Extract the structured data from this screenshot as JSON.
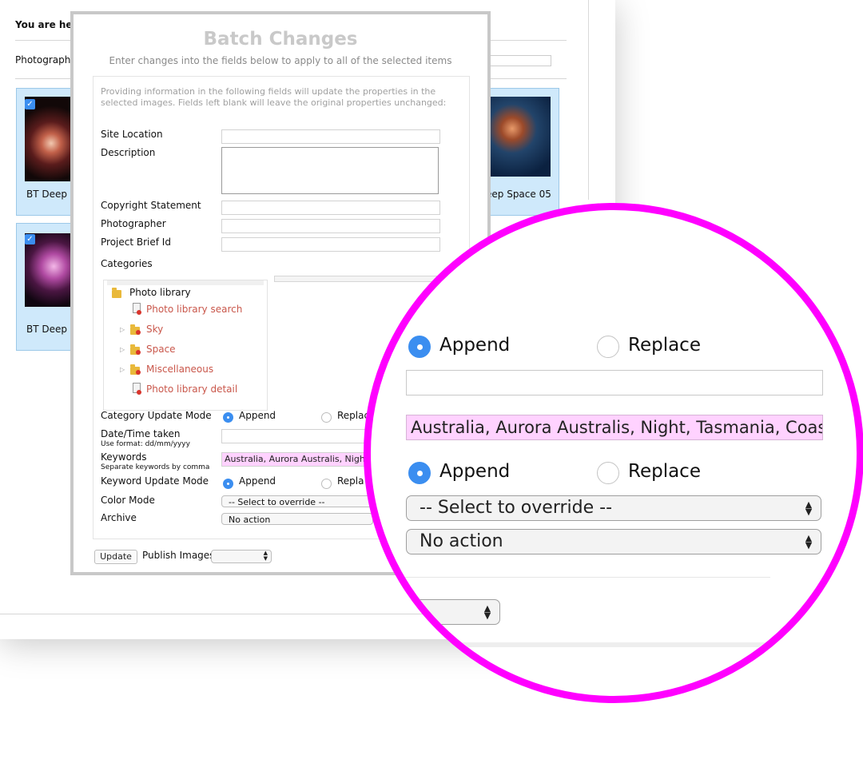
{
  "background": {
    "breadcrumb_label": "You are her",
    "photographer_label": "Photographe",
    "tiles": [
      {
        "label": "BT Deep S"
      },
      {
        "label": "BT Deep S"
      },
      {
        "label": "eep Space 05"
      }
    ]
  },
  "dialog": {
    "title": "Batch Changes",
    "subtitle": "Enter changes into the fields below to apply to all of the selected items",
    "info": "Providing information in the following fields will update the properties in the selected images. Fields left blank will leave the original properties unchanged:",
    "fields": {
      "site_location": "Site Location",
      "description": "Description",
      "copyright": "Copyright Statement",
      "photographer": "Photographer",
      "project_brief": "Project Brief Id",
      "categories": "Categories",
      "category_update_mode": "Category Update Mode",
      "date_taken": "Date/Time taken",
      "date_hint": "Use format: dd/mm/yyyy",
      "keywords": "Keywords",
      "keywords_hint": "Separate keywords by comma",
      "keyword_update_mode": "Keyword Update Mode",
      "color_mode": "Color Mode",
      "archive": "Archive"
    },
    "tree": {
      "root": "Photo library",
      "items": [
        "Photo library search",
        "Sky",
        "Space",
        "Miscellaneous",
        "Photo library detail"
      ]
    },
    "append_label": "Append",
    "replace_label_cut": "Replac",
    "replace_label_cut2": "Repla",
    "keywords_value": "Australia, Aurora Australis, Night",
    "keywords_tail": "ma",
    "color_mode_value": "-- Select to override --",
    "archive_value": "No action",
    "update_button": "Update",
    "publish_label": "Publish Images"
  },
  "magnifier": {
    "append": "Append",
    "replace": "Replace",
    "keywords_value": "Australia, Aurora Australis, Night, Tasmania, Coastli",
    "color_mode_value": "-- Select to override --",
    "archive_value": "No action"
  },
  "colors": {
    "accent": "#3b8ef0",
    "magnifier_ring": "#ff00ff",
    "keywords_highlight": "#ffd2ff",
    "tree_link": "#c9574b"
  }
}
